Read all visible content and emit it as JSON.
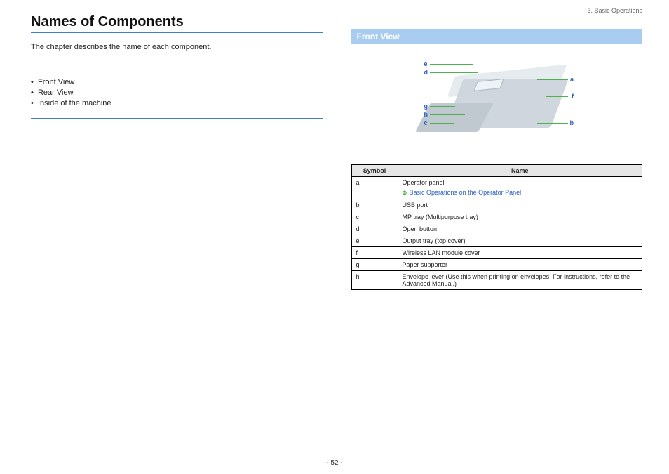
{
  "breadcrumb": "3. Basic Operations",
  "title": "Names of Components",
  "intro": "The chapter describes the name of each component.",
  "toc": [
    "Front View",
    "Rear View",
    "Inside of the machine"
  ],
  "section_heading": "Front View",
  "labels": {
    "a": "a",
    "b": "b",
    "c": "c",
    "d": "d",
    "e": "e",
    "f": "f",
    "g": "g",
    "h": "h"
  },
  "table": {
    "headers": {
      "symbol": "Symbol",
      "name": "Name"
    },
    "rows": [
      {
        "symbol": "a",
        "name": "Operator panel",
        "link": "Basic Operations on the Operator Panel"
      },
      {
        "symbol": "b",
        "name": "USB port"
      },
      {
        "symbol": "c",
        "name": "MP tray (Multipurpose tray)"
      },
      {
        "symbol": "d",
        "name": "Open button"
      },
      {
        "symbol": "e",
        "name": "Output tray (top cover)"
      },
      {
        "symbol": "f",
        "name": "Wireless LAN module cover"
      },
      {
        "symbol": "g",
        "name": "Paper supporter"
      },
      {
        "symbol": "h",
        "name": "Envelope lever (Use this when printing on envelopes. For instructions, refer to the Advanced Manual.)"
      }
    ]
  },
  "page_number": "- 52 -"
}
